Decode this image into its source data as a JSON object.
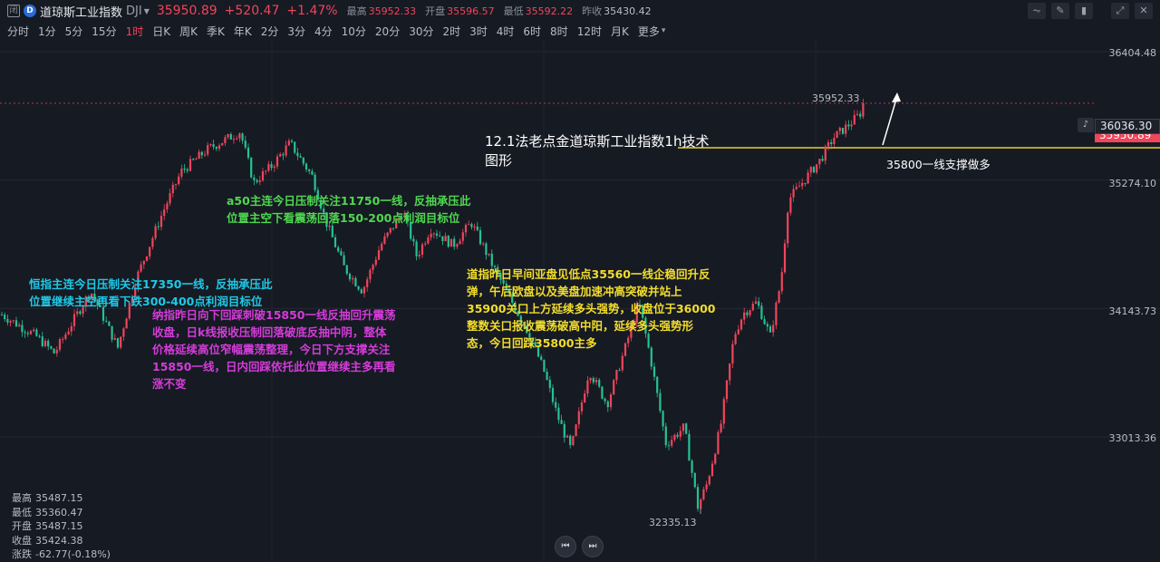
{
  "header": {
    "box_glyph": "闭",
    "logo_glyph": "D",
    "name": "道琼斯工业指数",
    "code": "DJI",
    "price": "35950.89",
    "change": "+520.47",
    "change_pct": "+1.47%",
    "high_label": "最高",
    "high_value": "35952.33",
    "open_label": "开盘",
    "open_value": "35596.57",
    "low_label": "最低",
    "low_value": "35592.22",
    "prev_label": "昨收",
    "prev_value": "35430.42",
    "tool_icons": [
      "indicator-icon",
      "draw-icon",
      "candle-icon",
      "expand-icon",
      "close-icon"
    ]
  },
  "periods": {
    "items": [
      "分时",
      "1分",
      "5分",
      "15分",
      "1时",
      "日K",
      "周K",
      "季K",
      "年K",
      "2分",
      "3分",
      "4分",
      "10分",
      "20分",
      "30分",
      "2时",
      "3时",
      "4时",
      "6时",
      "8时",
      "12时",
      "月K",
      "更多"
    ],
    "active": "1时"
  },
  "y_axis": {
    "top": "36404.48",
    "alert": "36036.30",
    "current": "35950.89",
    "l1": "35274.10",
    "l2": "34143.73",
    "l3": "33013.36"
  },
  "markers": {
    "high": "35952.33",
    "low": "32335.13"
  },
  "annotations": {
    "cyan_1": "恒指主连今日压制关注17350一线，反抽承压此",
    "cyan_2": "位置继续主空再看下跌300-400点利润目标位",
    "green_1": "a50主连今日压制关注11750一线，反抽承压此",
    "green_2": "位置主空下看震荡回落150-200点利润目标位",
    "magenta_1": "纳指昨日向下回踩刺破15850一线反抽回升震荡",
    "magenta_2": "收盘，日k线报收压制回落破底反抽中阴，整体",
    "magenta_3": "价格延续高位窄幅震荡整理，今日下方支撑关注",
    "magenta_4": "15850一线，日内回踩依托此位置继续主多再看",
    "magenta_5": "涨不变",
    "yellow_1": "道指昨日早间亚盘见低点35560一线企稳回升反",
    "yellow_2": "弹，午后欧盘以及美盘加速冲高突破并站上",
    "yellow_3": "35900关口上方延续多头强势，收盘位于36000",
    "yellow_4": "整数关口报收震荡破高中阳，延续多头强势形",
    "yellow_5": "态，今日回踩35800主多",
    "title_1": "12.1法老点金道琼斯工业指数1h技术",
    "title_2": "图形",
    "support": "35800一线支撑做多"
  },
  "stats": {
    "high_label": "最高",
    "high": "35487.15",
    "low_label": "最低",
    "low": "35360.47",
    "open_label": "开盘",
    "open": "35487.15",
    "close_label": "收盘",
    "close": "35424.38",
    "change_label": "涨跌",
    "change": "-62.77(-0.18%)"
  },
  "nav": {
    "prev_glyph": "⏮",
    "next_glyph": "⏭"
  },
  "colors": {
    "up": "#f0455a",
    "down": "#27c193",
    "background": "#161a23",
    "support_line": "#e8d21e"
  },
  "chart_data": {
    "type": "candlestick",
    "y_axis_ticks": [
      36404.48,
      35274.1,
      34143.73,
      33013.36
    ],
    "shape_keypoints": [
      [
        0,
        34100
      ],
      [
        40,
        33900
      ],
      [
        60,
        33750
      ],
      [
        100,
        34300
      ],
      [
        130,
        33800
      ],
      [
        150,
        34400
      ],
      [
        180,
        35000
      ],
      [
        200,
        35350
      ],
      [
        230,
        35550
      ],
      [
        265,
        35700
      ],
      [
        280,
        35250
      ],
      [
        300,
        35400
      ],
      [
        320,
        35600
      ],
      [
        345,
        35300
      ],
      [
        360,
        34900
      ],
      [
        380,
        34500
      ],
      [
        400,
        34300
      ],
      [
        420,
        34700
      ],
      [
        445,
        35000
      ],
      [
        460,
        34600
      ],
      [
        475,
        34850
      ],
      [
        500,
        34700
      ],
      [
        520,
        34900
      ],
      [
        545,
        34500
      ],
      [
        565,
        34200
      ],
      [
        585,
        33900
      ],
      [
        600,
        33600
      ],
      [
        615,
        33200
      ],
      [
        630,
        32900
      ],
      [
        650,
        33600
      ],
      [
        670,
        33300
      ],
      [
        690,
        33800
      ],
      [
        705,
        34200
      ],
      [
        718,
        33700
      ],
      [
        735,
        32950
      ],
      [
        755,
        33100
      ],
      [
        770,
        32400
      ],
      [
        780,
        32600
      ],
      [
        795,
        33100
      ],
      [
        810,
        33900
      ],
      [
        820,
        34100
      ],
      [
        835,
        34200
      ],
      [
        850,
        33900
      ],
      [
        862,
        34400
      ],
      [
        870,
        35100
      ],
      [
        885,
        35250
      ],
      [
        905,
        35450
      ],
      [
        920,
        35650
      ],
      [
        935,
        35750
      ],
      [
        948,
        35850
      ],
      [
        956,
        35952
      ]
    ]
  }
}
